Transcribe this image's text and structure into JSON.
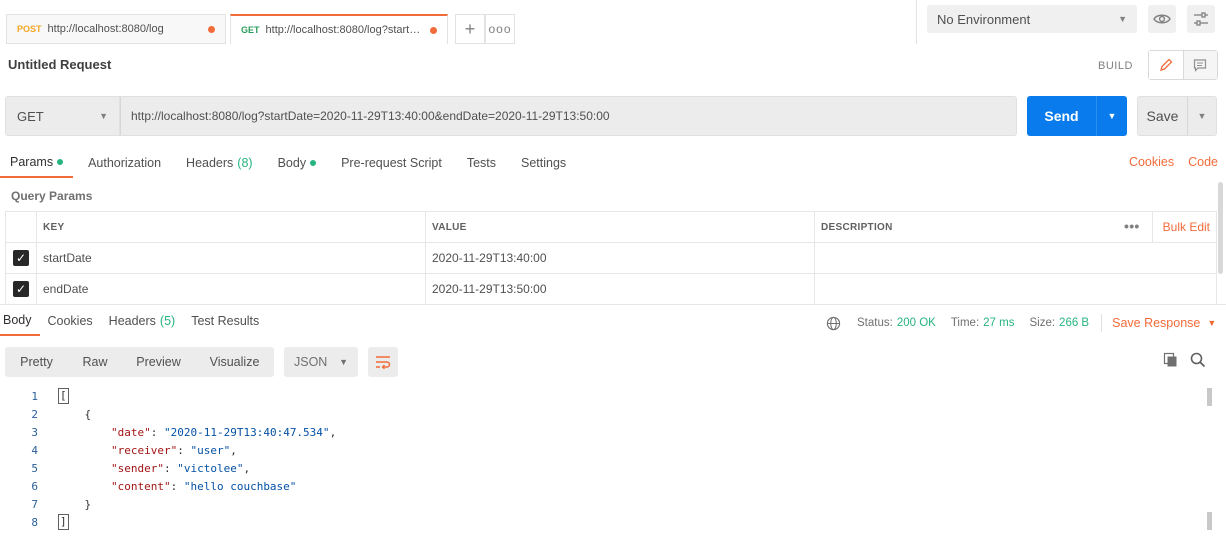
{
  "tabs": [
    {
      "method": "POST",
      "url": "http://localhost:8080/log"
    },
    {
      "method": "GET",
      "url": "http://localhost:8080/log?startD..."
    }
  ],
  "tab_add": "+",
  "tab_more": "ooo",
  "environment": {
    "selected": "No Environment"
  },
  "request": {
    "title": "Untitled Request",
    "build_label": "BUILD",
    "method": "GET",
    "url": "http://localhost:8080/log?startDate=2020-11-29T13:40:00&endDate=2020-11-29T13:50:00",
    "send_label": "Send",
    "save_label": "Save"
  },
  "request_tabs": {
    "params": "Params",
    "authorization": "Authorization",
    "headers": "Headers",
    "headers_count": "(8)",
    "body": "Body",
    "prerequest": "Pre-request Script",
    "tests": "Tests",
    "settings": "Settings",
    "cookies": "Cookies",
    "code": "Code"
  },
  "query_params": {
    "title": "Query Params",
    "headers": {
      "key": "KEY",
      "value": "VALUE",
      "description": "DESCRIPTION"
    },
    "more": "•••",
    "bulk_edit": "Bulk Edit",
    "rows": [
      {
        "key": "startDate",
        "value": "2020-11-29T13:40:00",
        "description": ""
      },
      {
        "key": "endDate",
        "value": "2020-11-29T13:50:00",
        "description": ""
      }
    ]
  },
  "response_tabs": {
    "body": "Body",
    "cookies": "Cookies",
    "headers": "Headers",
    "headers_count": "(5)",
    "test_results": "Test Results"
  },
  "response_status": {
    "status_label": "Status:",
    "status_value": "200 OK",
    "time_label": "Time:",
    "time_value": "27 ms",
    "size_label": "Size:",
    "size_value": "266 B",
    "save_response": "Save Response"
  },
  "response_view": {
    "modes": [
      "Pretty",
      "Raw",
      "Preview",
      "Visualize"
    ],
    "format": "JSON"
  },
  "response_body": {
    "line_numbers": [
      "1",
      "2",
      "3",
      "4",
      "5",
      "6",
      "7",
      "8"
    ],
    "open_bracket": "[",
    "open_brace": "{",
    "close_brace": "}",
    "close_bracket": "]",
    "fields": [
      {
        "key": "\"date\"",
        "value": "\"2020-11-29T13:40:47.534\"",
        "sep": ","
      },
      {
        "key": "\"receiver\"",
        "value": "\"user\"",
        "sep": ","
      },
      {
        "key": "\"sender\"",
        "value": "\"victolee\"",
        "sep": ","
      },
      {
        "key": "\"content\"",
        "value": "\"hello couchbase\"",
        "sep": ""
      }
    ]
  },
  "colors": {
    "accent": "#f26b3a",
    "send": "#097bed",
    "success": "#26b47f"
  }
}
